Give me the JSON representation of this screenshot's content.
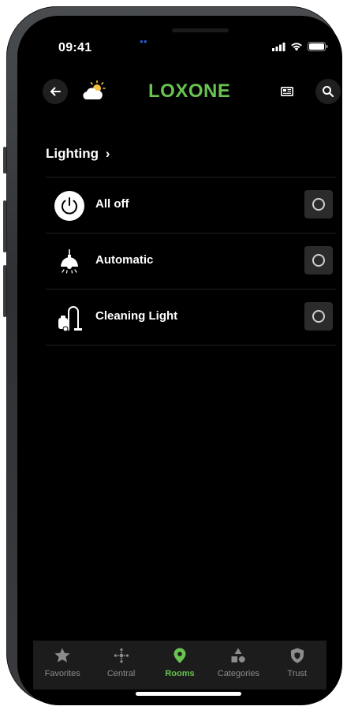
{
  "status_bar": {
    "time": "09:41"
  },
  "header": {
    "logo": "LOXONE",
    "back_icon": "arrow-left-icon",
    "weather_icon": "partly-sunny-icon",
    "news_icon": "newspaper-icon",
    "search_icon": "search-icon"
  },
  "section": {
    "title": "Lighting",
    "chevron": "›"
  },
  "items": [
    {
      "label": "All off",
      "icon": "power-icon",
      "state": "off"
    },
    {
      "label": "Automatic",
      "icon": "ceiling-lamp-icon",
      "state": "off"
    },
    {
      "label": "Cleaning Light",
      "icon": "vacuum-cleaner-icon",
      "state": "off"
    }
  ],
  "tabs": [
    {
      "label": "Favorites",
      "icon": "star-icon",
      "active": false
    },
    {
      "label": "Central",
      "icon": "central-dots-icon",
      "active": false
    },
    {
      "label": "Rooms",
      "icon": "location-pin-icon",
      "active": true
    },
    {
      "label": "Categories",
      "icon": "shapes-icon",
      "active": false
    },
    {
      "label": "Trust",
      "icon": "shield-icon",
      "active": false
    }
  ],
  "colors": {
    "accent": "#69c350",
    "background": "#000000",
    "tab_inactive": "#8c8c8c"
  }
}
